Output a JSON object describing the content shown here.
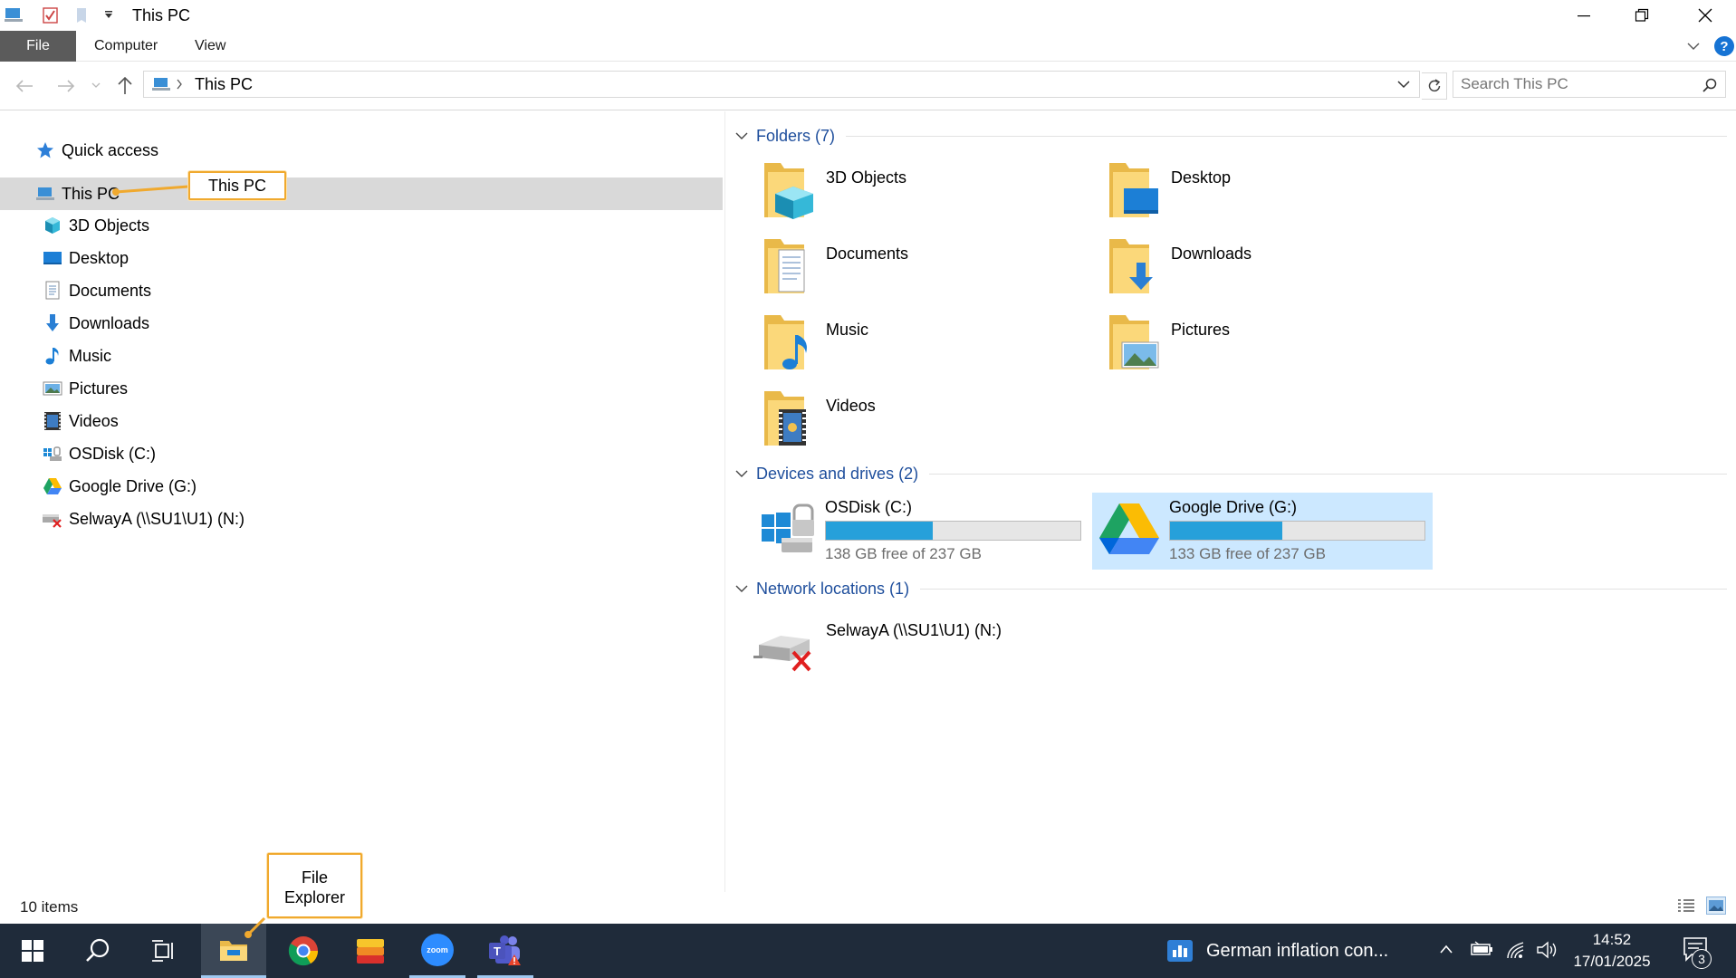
{
  "window": {
    "title": "This PC"
  },
  "ribbon": {
    "tabs": [
      "File",
      "Computer",
      "View"
    ]
  },
  "address": {
    "location": "This PC"
  },
  "search": {
    "placeholder": "Search This PC"
  },
  "nav": {
    "quick_access": "Quick access",
    "this_pc": "This PC",
    "items": [
      "3D Objects",
      "Desktop",
      "Documents",
      "Downloads",
      "Music",
      "Pictures",
      "Videos",
      "OSDisk (C:)",
      "Google Drive (G:)",
      "SelwayA (\\\\SU1\\U1) (N:)"
    ]
  },
  "groups": {
    "folders": "Folders (7)",
    "devices": "Devices and drives (2)",
    "network": "Network locations (1)"
  },
  "folders": [
    "3D Objects",
    "Desktop",
    "Documents",
    "Downloads",
    "Music",
    "Pictures",
    "Videos"
  ],
  "drives": [
    {
      "name": "OSDisk (C:)",
      "free": "138 GB free of 237 GB",
      "used_fraction": 0.42
    },
    {
      "name": "Google Drive (G:)",
      "free": "133 GB free of 237 GB",
      "used_fraction": 0.44
    }
  ],
  "network_location": "SelwayA (\\\\SU1\\U1) (N:)",
  "status": {
    "items": "10 items"
  },
  "callouts": {
    "this_pc": "This PC",
    "file_explorer": "File Explorer"
  },
  "taskbar": {
    "active_window": "German inflation con...",
    "time": "14:52",
    "date": "17/01/2025",
    "notifications": "3",
    "zoom_label": "zoom"
  },
  "colors": {
    "accent": "#26a0da",
    "selected": "#cce8ff",
    "nav_selected": "#d9d9d9",
    "taskbar": "#1f2b3a",
    "callout_border": "#f0a92e"
  }
}
